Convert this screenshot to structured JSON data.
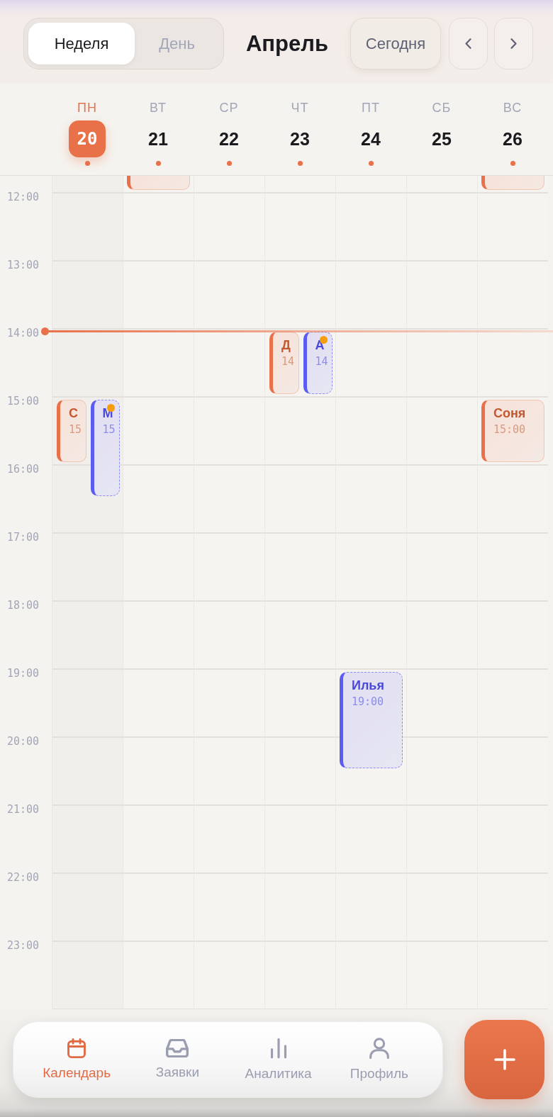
{
  "view_toggle": [
    {
      "label": "Неделя",
      "selected": true
    },
    {
      "label": "День",
      "selected": false
    }
  ],
  "month": "Апрель",
  "today_button": "Сегодня",
  "days": [
    {
      "weekday": "ПН",
      "date": "20",
      "selected": true,
      "has_events": true
    },
    {
      "weekday": "ВТ",
      "date": "21",
      "selected": false,
      "has_events": true
    },
    {
      "weekday": "СР",
      "date": "22",
      "selected": false,
      "has_events": true
    },
    {
      "weekday": "ЧТ",
      "date": "23",
      "selected": false,
      "has_events": true
    },
    {
      "weekday": "ПТ",
      "date": "24",
      "selected": false,
      "has_events": true
    },
    {
      "weekday": "СБ",
      "date": "25",
      "selected": false,
      "has_events": false
    },
    {
      "weekday": "ВС",
      "date": "26",
      "selected": false,
      "has_events": true
    }
  ],
  "top_partial_row": {
    "cells": [
      {},
      {
        "events": [
          {
            "kind": "confirmed",
            "flagged": false
          }
        ]
      },
      {},
      {},
      {},
      {},
      {
        "events": [
          {
            "kind": "confirmed",
            "flagged": false
          }
        ]
      }
    ]
  },
  "hours": [
    {
      "label": "12:00",
      "current": false
    },
    {
      "label": "13:00",
      "current": false
    },
    {
      "label": "14:00",
      "current": true,
      "cells": [
        {},
        {},
        {},
        {
          "events": [
            {
              "kind": "confirmed",
              "name": "Д",
              "time": "14",
              "long": false,
              "flagged": false
            },
            {
              "kind": "pending",
              "name": "А",
              "time": "14",
              "long": false,
              "flagged": true
            }
          ]
        }
      ]
    },
    {
      "label": "15:00",
      "current": false,
      "cells": [
        {
          "events": [
            {
              "kind": "confirmed",
              "name": "С",
              "time": "15",
              "long": false,
              "flagged": false
            },
            {
              "kind": "pending",
              "name": "М",
              "time": "15",
              "long": true,
              "flagged": true
            }
          ]
        },
        {},
        {},
        {},
        {},
        {},
        {
          "events": [
            {
              "kind": "confirmed",
              "name": "Соня",
              "time": "15:00",
              "long": false,
              "flagged": false
            }
          ]
        }
      ]
    },
    {
      "label": "16:00",
      "current": false
    },
    {
      "label": "17:00",
      "current": false
    },
    {
      "label": "18:00",
      "current": false
    },
    {
      "label": "19:00",
      "current": false,
      "cells": [
        {},
        {},
        {},
        {},
        {
          "events": [
            {
              "kind": "pending",
              "name": "Илья",
              "time": "19:00",
              "long": true,
              "flagged": false
            }
          ]
        }
      ]
    },
    {
      "label": "20:00",
      "current": false
    },
    {
      "label": "21:00",
      "current": false
    },
    {
      "label": "22:00",
      "current": false
    },
    {
      "label": "23:00",
      "current": false
    }
  ],
  "nav": [
    {
      "label": "Календарь",
      "selected": true
    },
    {
      "label": "Заявки",
      "selected": false
    },
    {
      "label": "Аналитика",
      "selected": false
    },
    {
      "label": "Профиль",
      "selected": false
    }
  ]
}
